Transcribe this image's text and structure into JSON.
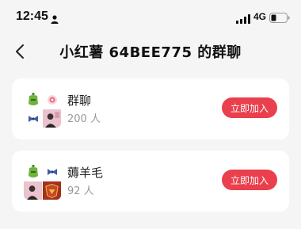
{
  "status_bar": {
    "time": "12:45",
    "network": "4G"
  },
  "nav": {
    "title": "小红薯 64BEE775 的群聊"
  },
  "groups": [
    {
      "name": "群聊",
      "members": "200 人",
      "join_label": "立即加入"
    },
    {
      "name": "薅羊毛",
      "members": "92 人",
      "join_label": "立即加入"
    }
  ],
  "colors": {
    "accent": "#ea3f4c",
    "background": "#f5f5f5",
    "card": "#ffffff"
  }
}
